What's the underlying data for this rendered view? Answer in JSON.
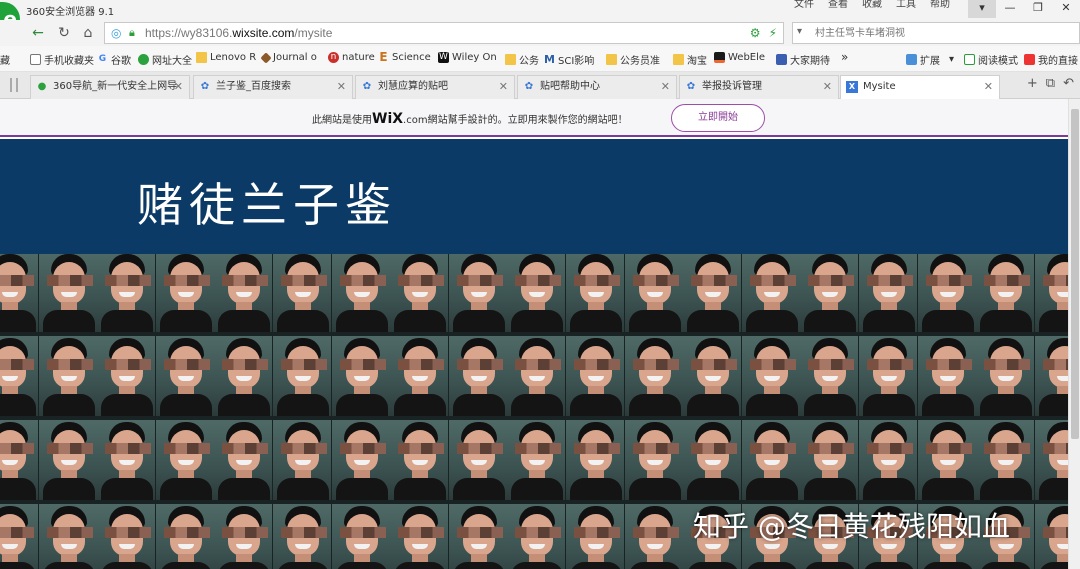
{
  "titlebar": {
    "app_title": "360安全浏览器 9.1",
    "menu": [
      "文件",
      "查看",
      "收藏",
      "工具",
      "帮助"
    ],
    "logo_glyph": "e"
  },
  "addressbar": {
    "url_prefix": "https://wy83106.",
    "url_domain": "wixsite.com",
    "url_path": "/mysite",
    "search_placeholder": "村主任骂卡车堵洞视"
  },
  "bookmarks": [
    {
      "label": "藏",
      "icon": "none"
    },
    {
      "label": "手机收藏夹",
      "icon": "phone"
    },
    {
      "label": "谷歌",
      "icon": "google"
    },
    {
      "label": "网址大全",
      "icon": "360"
    },
    {
      "label": "Lenovo R",
      "icon": "folder"
    },
    {
      "label": "Journal o",
      "icon": "diamond"
    },
    {
      "label": "nature",
      "icon": "nature"
    },
    {
      "label": "Science",
      "icon": "science"
    },
    {
      "label": "Wiley On",
      "icon": "wiley"
    },
    {
      "label": "公务",
      "icon": "folder"
    },
    {
      "label": "SCI影响",
      "icon": "mscience"
    },
    {
      "label": "公务员准",
      "icon": "folder"
    },
    {
      "label": "淘宝",
      "icon": "folder"
    },
    {
      "label": "WebEle",
      "icon": "webele"
    },
    {
      "label": "大家期待",
      "icon": "group"
    },
    {
      "label": "»",
      "icon": "none"
    },
    {
      "label": "扩展",
      "icon": "grid"
    },
    {
      "label": "阅读模式",
      "icon": "read"
    },
    {
      "label": "我的直接",
      "icon": "mine"
    }
  ],
  "tabs": [
    {
      "label": "360导航_新一代安全上网导",
      "icon": "360",
      "active": false
    },
    {
      "label": "兰子鉴_百度搜索",
      "icon": "baidu",
      "active": false
    },
    {
      "label": "刘慧应算的贴吧",
      "icon": "baidu",
      "active": false
    },
    {
      "label": "贴吧帮助中心",
      "icon": "baidu",
      "active": false
    },
    {
      "label": "举报投诉管理",
      "icon": "baidu",
      "active": false
    },
    {
      "label": "Mysite",
      "icon": "wix",
      "active": true
    }
  ],
  "wix_banner": {
    "text_before": "此網站是使用",
    "brand": "WiX",
    "text_after": ".com網站幫手設計的。立即用來製作您的網站吧！",
    "cta": "立即開始"
  },
  "site": {
    "title": "赌徒兰子鉴"
  },
  "watermark": "知乎 @冬日黄花残阳如血",
  "colors": {
    "header_bg": "#0c3a66",
    "banner_accent": "#7b3a9b",
    "browser_green": "#2e8b3d"
  }
}
